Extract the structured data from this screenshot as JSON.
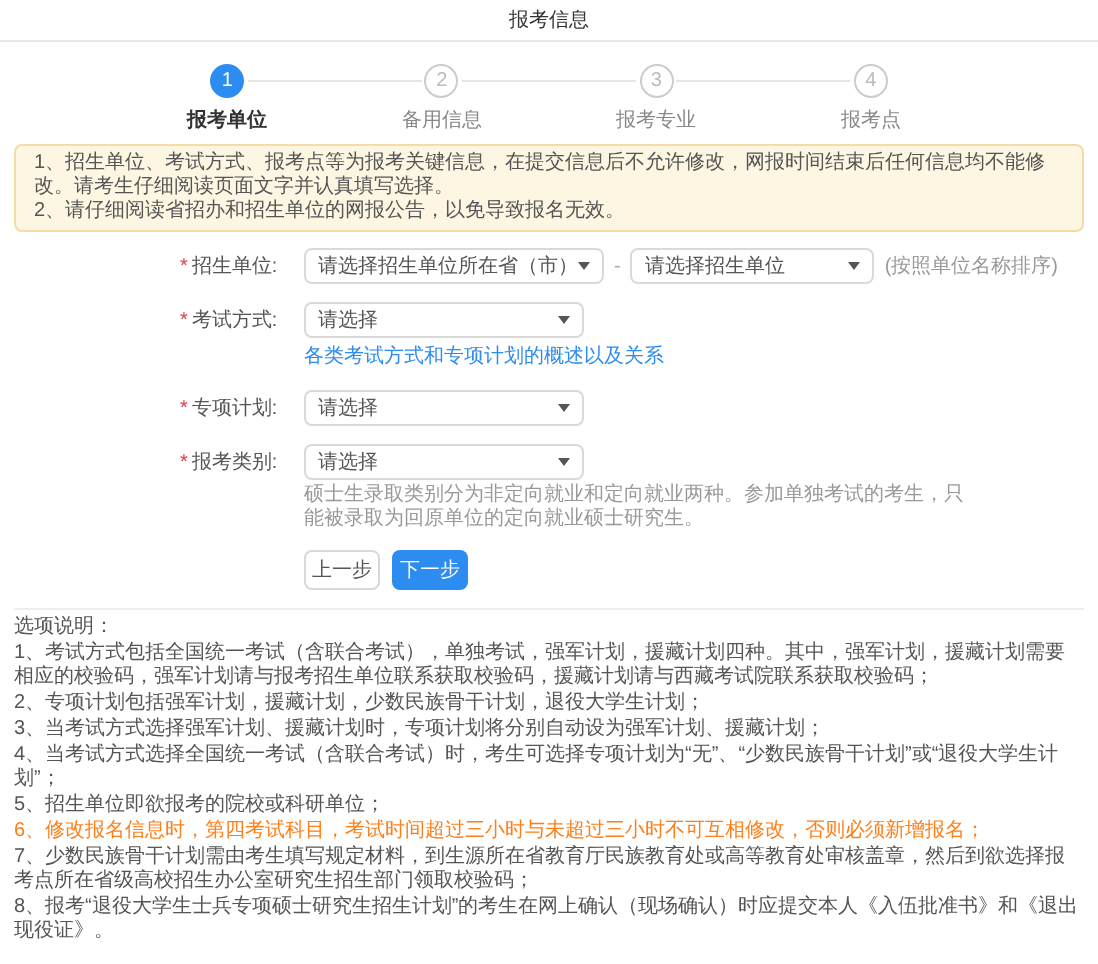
{
  "header": {
    "title": "报考信息"
  },
  "steps": [
    {
      "number": "1",
      "label": "报考单位",
      "selected": true
    },
    {
      "number": "2",
      "label": "备用信息",
      "selected": false
    },
    {
      "number": "3",
      "label": "报考专业",
      "selected": false
    },
    {
      "number": "4",
      "label": "报考点",
      "selected": false
    }
  ],
  "notice": [
    "1、招生单位、考试方式、报考点等为报考关键信息，在提交信息后不允许修改，网报时间结束后任何信息均不能修改。请考生仔细阅读页面文字并认真填写选择。",
    "2、请仔细阅读省招办和招生单位的网报公告，以免导致报名无效。"
  ],
  "form": [
    {
      "label": "招生单位:",
      "required": true,
      "required_mark": "*",
      "selects": [
        "请选择招生单位所在省（市）",
        "请选择招生单位"
      ],
      "separator": "-",
      "hint": "(按照单位名称排序)"
    },
    {
      "label": "考试方式:",
      "required": true,
      "required_mark": "*",
      "selects": [
        "请选择"
      ],
      "link": "各类考试方式和专项计划的概述以及关系"
    },
    {
      "label": "专项计划:",
      "required": true,
      "required_mark": "*",
      "selects": [
        "请选择"
      ]
    },
    {
      "label": "报考类别:",
      "required": true,
      "required_mark": "*",
      "selects": [
        "请选择"
      ],
      "description": "硕士生录取类别分为非定向就业和定向就业两种。参加单独考试的考生，只能被录取为回原单位的定向就业硕士研究生。"
    }
  ],
  "buttons": [
    {
      "label": "上一步",
      "kind": "secondary"
    },
    {
      "label": "下一步",
      "kind": "primary"
    }
  ],
  "notes": {
    "title": "选项说明：",
    "items": [
      {
        "text": "1、考试方式包括全国统一考试（含联合考试），单独考试，强军计划，援藏计划四种。其中，强军计划，援藏计划需要相应的校验码，强军计划请与报考招生单位联系获取校验码，援藏计划请与西藏考试院联系获取校验码；",
        "highlighted": false
      },
      {
        "text": "2、专项计划包括强军计划，援藏计划，少数民族骨干计划，退役大学生计划；",
        "highlighted": false
      },
      {
        "text": "3、当考试方式选择强军计划、援藏计划时，专项计划将分别自动设为强军计划、援藏计划；",
        "highlighted": false
      },
      {
        "text": "4、当考试方式选择全国统一考试（含联合考试）时，考生可选择专项计划为“无”、“少数民族骨干计划”或“退役大学生计划”；",
        "highlighted": false
      },
      {
        "text": "5、招生单位即欲报考的院校或科研单位；",
        "highlighted": false
      },
      {
        "text": "6、修改报名信息时，第四考试科目，考试时间超过三小时与未超过三小时不可互相修改，否则必须新增报名；",
        "highlighted": true
      },
      {
        "text": "7、少数民族骨干计划需由考生填写规定材料，到生源所在省教育厅民族教育处或高等教育处审核盖章，然后到欲选择报考点所在省级高校招生办公室研究生招生部门领取校验码；",
        "highlighted": false
      },
      {
        "text": "8、报考“退役大学生士兵专项硕士研究生招生计划”的考生在网上确认（现场确认）时应提交本人《入伍批准书》和《退出现役证》。",
        "highlighted": false
      }
    ]
  }
}
